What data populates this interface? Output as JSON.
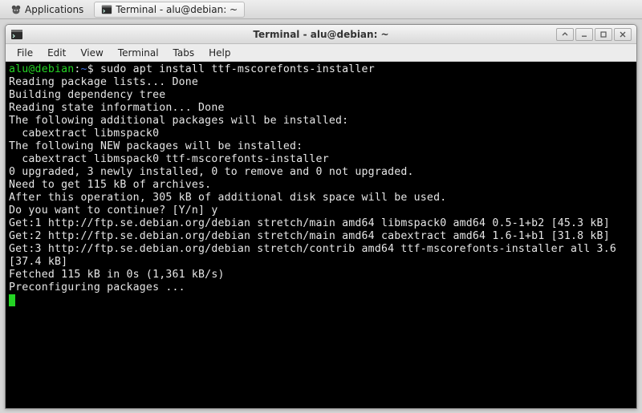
{
  "taskbar": {
    "applications_label": "Applications",
    "task_label": "Terminal - alu@debian: ~"
  },
  "window": {
    "title": "Terminal - alu@debian: ~"
  },
  "menubar": {
    "items": [
      {
        "label": "File"
      },
      {
        "label": "Edit"
      },
      {
        "label": "View"
      },
      {
        "label": "Terminal"
      },
      {
        "label": "Tabs"
      },
      {
        "label": "Help"
      }
    ]
  },
  "terminal": {
    "prompt_userhost": "alu@debian",
    "prompt_sep": ":",
    "prompt_path": "~",
    "prompt_dollar": "$ ",
    "command": "sudo apt install ttf-mscorefonts-installer",
    "lines": [
      "Reading package lists... Done",
      "Building dependency tree",
      "Reading state information... Done",
      "The following additional packages will be installed:",
      "  cabextract libmspack0",
      "The following NEW packages will be installed:",
      "  cabextract libmspack0 ttf-mscorefonts-installer",
      "0 upgraded, 3 newly installed, 0 to remove and 0 not upgraded.",
      "Need to get 115 kB of archives.",
      "After this operation, 305 kB of additional disk space will be used.",
      "Do you want to continue? [Y/n] y",
      "Get:1 http://ftp.se.debian.org/debian stretch/main amd64 libmspack0 amd64 0.5-1+b2 [45.3 kB]",
      "Get:2 http://ftp.se.debian.org/debian stretch/main amd64 cabextract amd64 1.6-1+b1 [31.8 kB]",
      "Get:3 http://ftp.se.debian.org/debian stretch/contrib amd64 ttf-mscorefonts-installer all 3.6 [37.4 kB]",
      "Fetched 115 kB in 0s (1,361 kB/s)",
      "Preconfiguring packages ..."
    ]
  }
}
